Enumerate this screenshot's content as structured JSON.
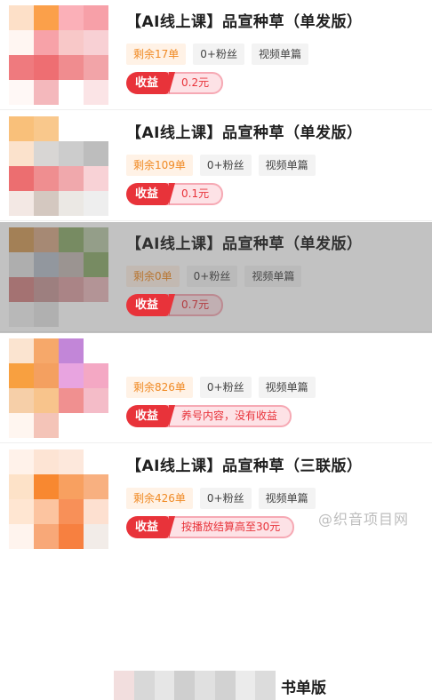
{
  "cards": [
    {
      "title": "【AI线上课】品宣种草（单发版）",
      "remain": "剩余17单",
      "fans": "0+粉丝",
      "type": "视频单篇",
      "earn_label": "收益",
      "earn_value": "0.2元"
    },
    {
      "title": "【AI线上课】品宣种草（单发版）",
      "remain": "剩余109单",
      "fans": "0+粉丝",
      "type": "视频单篇",
      "earn_label": "收益",
      "earn_value": "0.1元"
    },
    {
      "title": "【AI线上课】品宣种草（单发版）",
      "remain": "剩余0单",
      "fans": "0+粉丝",
      "type": "视频单篇",
      "earn_label": "收益",
      "earn_value": "0.7元",
      "disabled": true
    },
    {
      "title_visible_tail": "书单版",
      "remain": "剩余826单",
      "fans": "0+粉丝",
      "type": "视频单篇",
      "earn_label": "收益",
      "earn_value": "养号内容，没有收益"
    },
    {
      "title": "【AI线上课】品宣种草（三联版）",
      "remain": "剩余426单",
      "fans": "0+粉丝",
      "type": "视频单篇",
      "earn_label": "收益",
      "earn_value": "按播放结算高至30元"
    }
  ],
  "watermark": "@织音项目网",
  "colors": {
    "accent_red": "#e8333a",
    "remain_orange": "#f08a24",
    "earn_bg_pink": "#fde2e6",
    "tag_gray": "#f3f3f3"
  }
}
